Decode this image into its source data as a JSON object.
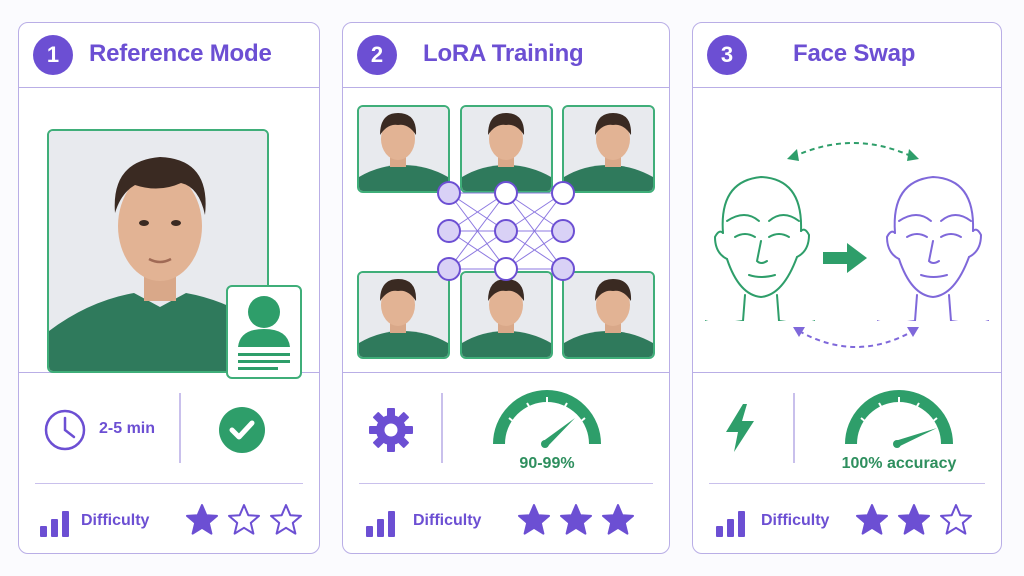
{
  "colors": {
    "purple": "#6c4fd3",
    "green": "#2e9e6a",
    "border": "#b9aee6"
  },
  "cards": [
    {
      "number": "1",
      "title": "Reference Mode",
      "time": "2-5 min",
      "difficulty_label": "Difficulty",
      "difficulty_stars": 1
    },
    {
      "number": "2",
      "title": "LoRA Training",
      "accuracy": "90-99%",
      "difficulty_label": "Difficulty",
      "difficulty_stars": 3
    },
    {
      "number": "3",
      "title": "Face Swap",
      "accuracy": "100% accuracy",
      "difficulty_label": "Difficulty",
      "difficulty_stars": 2
    }
  ],
  "icons": {
    "card1": [
      "portrait-photo",
      "id-card-icon",
      "clock-icon",
      "check-circle-icon",
      "bar-chart-icon"
    ],
    "card2": [
      "face-angle-photo",
      "neural-network-icon",
      "gear-icon",
      "gauge-icon",
      "bar-chart-icon"
    ],
    "card3": [
      "face-outline-icon",
      "arrow-right-icon",
      "swap-arrows-icon",
      "lightning-icon",
      "gauge-icon",
      "bar-chart-icon"
    ]
  }
}
